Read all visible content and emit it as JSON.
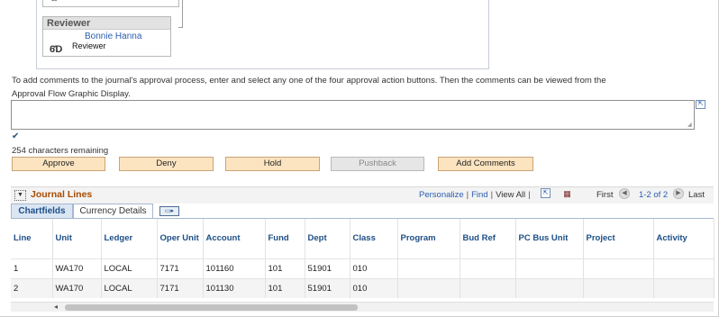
{
  "approval_flow": {
    "reviewer_step": {
      "title": "Reviewer",
      "name": "Bonnie Hanna",
      "role": "Reviewer",
      "icon": "glasses-icon"
    }
  },
  "instructions": "To add comments to the journal's approval process, enter and select any one of the four approval action buttons. Then the comments can be viewed from the Approval Flow Graphic Display.",
  "comment": {
    "value": "",
    "placeholder": ""
  },
  "chars_remaining": "254 characters remaining",
  "actions": {
    "approve": "Approve",
    "deny": "Deny",
    "hold": "Hold",
    "pushback": "Pushback",
    "add_comments": "Add Comments"
  },
  "grid": {
    "title": "Journal Lines",
    "personalize": "Personalize",
    "find": "Find",
    "view_all": "View All",
    "first": "First",
    "count": "1-2 of 2",
    "last": "Last",
    "tabs": [
      "Chartfields",
      "Currency Details"
    ],
    "columns": [
      "Line",
      "Unit",
      "Ledger",
      "Oper Unit",
      "Account",
      "Fund",
      "Dept",
      "Class",
      "Program",
      "Bud Ref",
      "PC Bus Unit",
      "Project",
      "Activity"
    ],
    "rows": [
      [
        "1",
        "WA170",
        "LOCAL",
        "7171",
        "101160",
        "101",
        "51901",
        "010",
        "",
        "",
        "",
        "",
        ""
      ],
      [
        "2",
        "WA170",
        "LOCAL",
        "7171",
        "101130",
        "101",
        "51901",
        "010",
        "",
        "",
        "",
        "",
        ""
      ]
    ]
  },
  "colors": {
    "link": "#2a5db0",
    "grid_title": "#a84b00",
    "button_bg": "#fde4c0",
    "header_text": "#1d4e86"
  }
}
